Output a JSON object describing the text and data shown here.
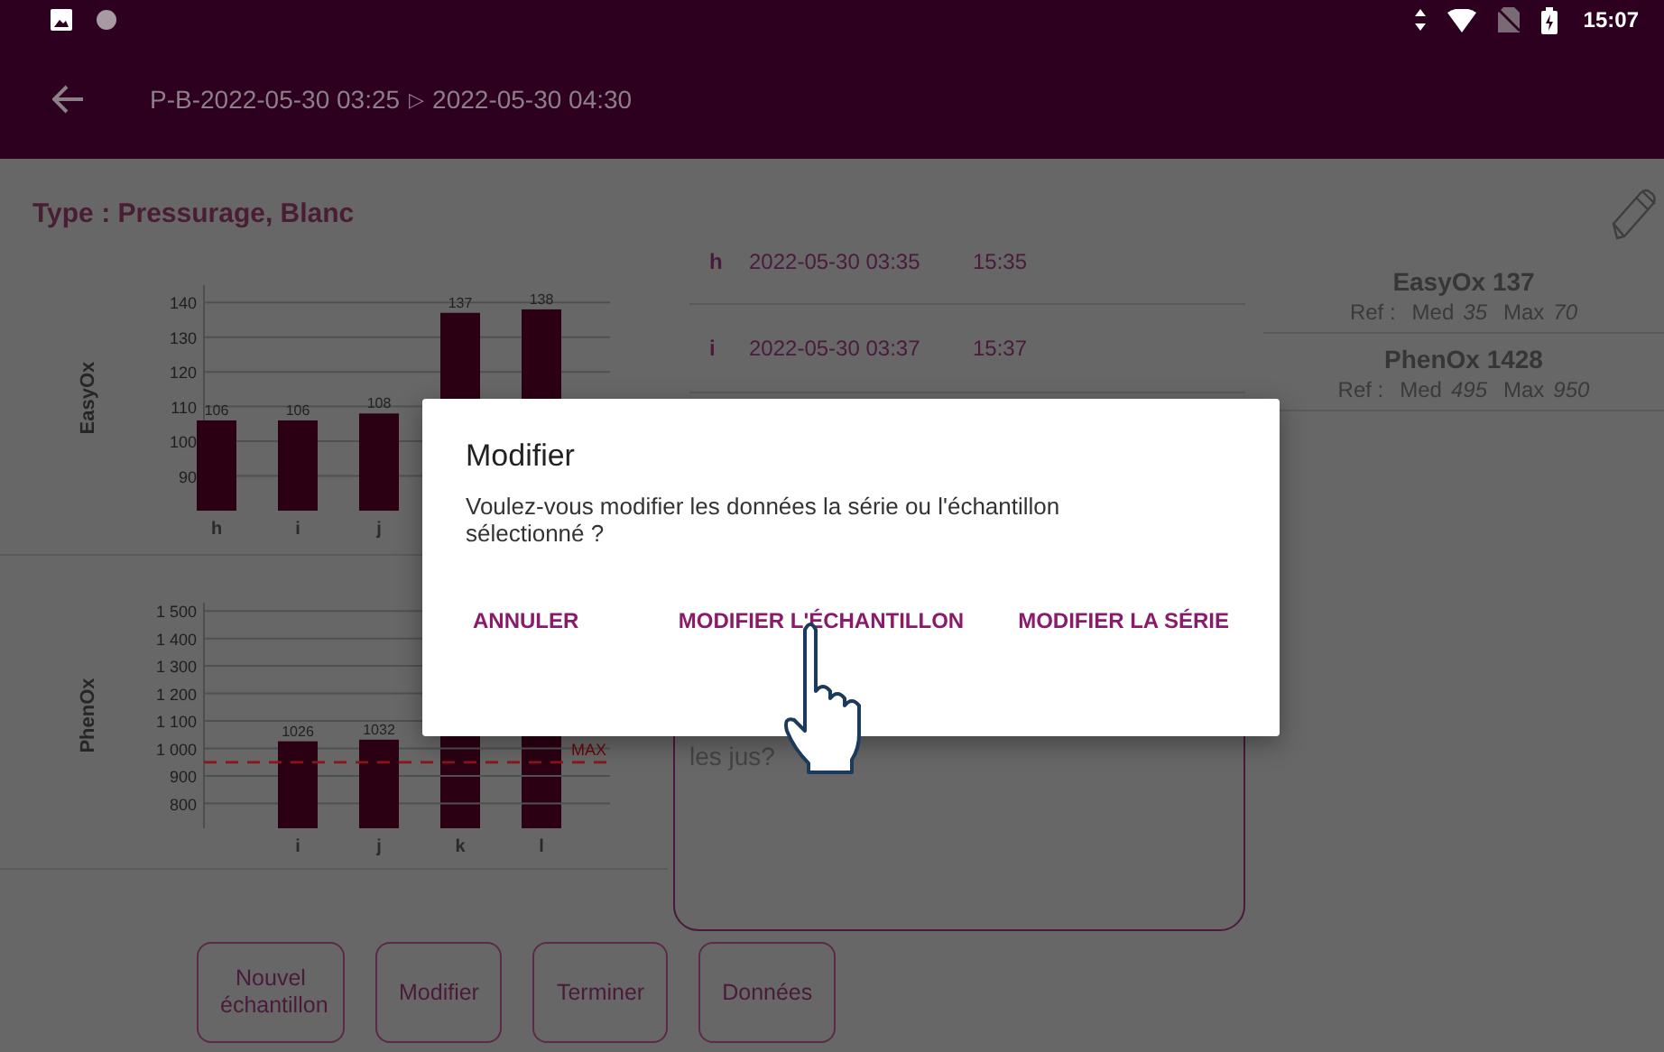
{
  "status_bar": {
    "time": "15:07"
  },
  "app_bar": {
    "title": "P-B-2022-05-30 03:25",
    "separator": "▷",
    "subtitle": "2022-05-30 04:30"
  },
  "type_label": "Type : Pressurage, Blanc",
  "charts": [
    {
      "chart_data": {
        "type": "bar",
        "ylabel": "EasyOx",
        "categories": [
          "h",
          "i",
          "j",
          null,
          null
        ],
        "values": [
          106,
          106,
          108,
          137,
          138
        ],
        "ylim": [
          80,
          145
        ],
        "yticks": [
          90,
          100,
          110,
          120,
          130,
          140
        ],
        "grid": true,
        "data_labels": true
      }
    },
    {
      "chart_data": {
        "type": "bar",
        "ylabel": "PhenOx",
        "categories": [
          "i",
          "j",
          "k",
          "l"
        ],
        "values": [
          1026,
          1032,
          null,
          null
        ],
        "ylim": [
          710,
          1530
        ],
        "yticks": [
          {
            "value": 800,
            "label": "800"
          },
          {
            "value": 900,
            "label": "900"
          },
          {
            "value": 1000,
            "label": "1 000"
          },
          {
            "value": 1100,
            "label": "1 100"
          },
          {
            "value": 1200,
            "label": "1 200"
          },
          {
            "value": 1300,
            "label": "1 300"
          },
          {
            "value": 1400,
            "label": "1 400"
          },
          {
            "value": 1500,
            "label": "1 500"
          }
        ],
        "grid": true,
        "value_labels": [
          "1026",
          "1032",
          null,
          null
        ],
        "ref_lines": [
          {
            "axis": "y",
            "value": 950,
            "label": "MAX"
          }
        ]
      }
    }
  ],
  "samples": [
    {
      "letter": "h",
      "date": "2022-05-30 03:35",
      "time": "15:35"
    },
    {
      "letter": "i",
      "date": "2022-05-30 03:37",
      "time": "15:37"
    }
  ],
  "references": [
    {
      "name": "EasyOx 137",
      "ref_label": "Ref :",
      "med_label": "Med",
      "med": "35",
      "max_label": "Max",
      "max": "70"
    },
    {
      "name": "PhenOx 1428",
      "ref_label": "Ref :",
      "med_label": "Med",
      "med": "495",
      "max_label": "Max",
      "max": "950"
    }
  ],
  "comment": {
    "value": "les jus?"
  },
  "buttons": [
    "Nouvel échantillon",
    "Modifier",
    "Terminer",
    "Données"
  ],
  "dialog": {
    "title": "Modifier",
    "message": "Voulez-vous modifier les données la série ou l'échantillon sélectionné ?",
    "actions": [
      "ANNULER",
      "MODIFIER L'ÉCHANTILLON",
      "MODIFIER LA SÉRIE"
    ]
  }
}
